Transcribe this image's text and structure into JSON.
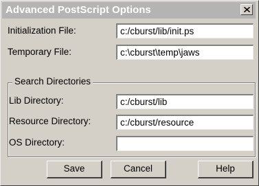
{
  "window": {
    "title": "Advanced PostScript Options"
  },
  "fields": {
    "initialization": {
      "label": "Initialization File:",
      "value": "c:/cburst/lib/init.ps"
    },
    "temporary": {
      "label": "Temporary File:",
      "value": "c:\\cburst\\temp\\jaws"
    }
  },
  "search": {
    "legend": "Search Directories",
    "lib": {
      "label": "Lib Directory:",
      "value": "c:/cburst/lib"
    },
    "resource": {
      "label": "Resource Directory:",
      "value": "c:/cburst/resource"
    },
    "os": {
      "label": "OS Directory:",
      "value": ""
    }
  },
  "buttons": {
    "save": "Save",
    "cancel": "Cancel",
    "help": "Help"
  },
  "icons": {
    "close": "close-icon"
  }
}
